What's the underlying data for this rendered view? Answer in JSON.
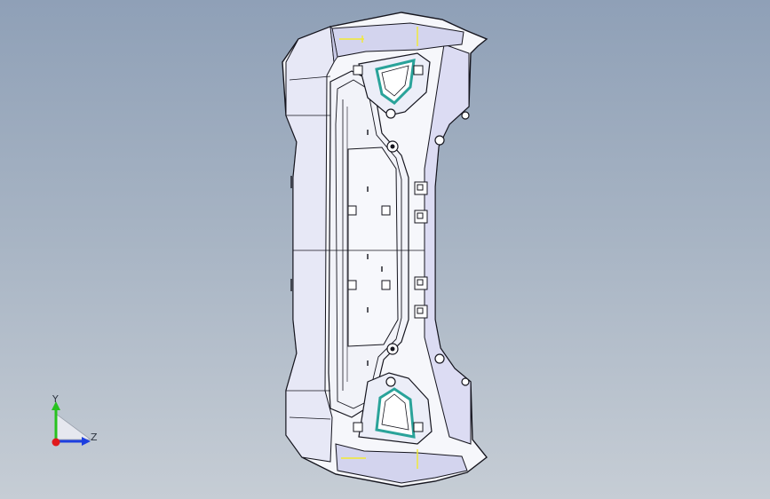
{
  "triad": {
    "y_label": "Y",
    "z_label": "Z",
    "colors": {
      "y": "#27c21e",
      "z": "#1d3fe0",
      "x": "#e0191c"
    }
  },
  "model": {
    "icon": "bumper-part-3d-model",
    "shell_fill": "#f7f8fc",
    "shade_fill": "#d8daf0",
    "edge_color": "#15151e",
    "accent_teal": "#2aa39a",
    "accent_yellow": "#f2ea30"
  }
}
